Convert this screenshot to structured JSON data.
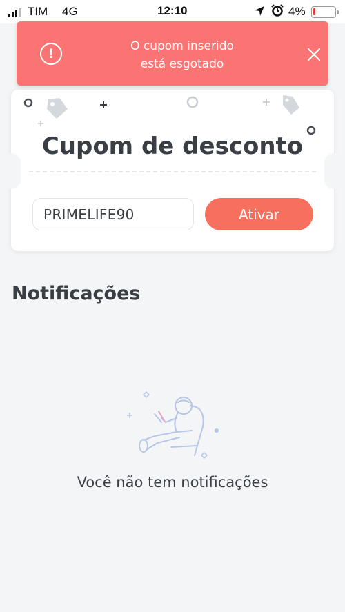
{
  "status_bar": {
    "carrier": "TIM",
    "network": "4G",
    "time": "12:10",
    "battery_percent": "4%",
    "icons": [
      "signal-icon",
      "location-arrow-icon",
      "alarm-clock-icon",
      "battery-icon"
    ]
  },
  "toast": {
    "message_line1": "O cupom inserido",
    "message_line2": "está esgotado",
    "background_color": "#fa7474",
    "icon": "alert-circle-icon",
    "close_icon": "close-icon"
  },
  "coupon": {
    "title": "Cupom de desconto",
    "input_value": "PRIMELIFE90",
    "activate_label": "Ativar",
    "accent_color": "#f7705e"
  },
  "notifications": {
    "heading": "Notificações",
    "empty_message": "Você não tem notificações",
    "illustration": "astronaut-reading-illustration"
  }
}
